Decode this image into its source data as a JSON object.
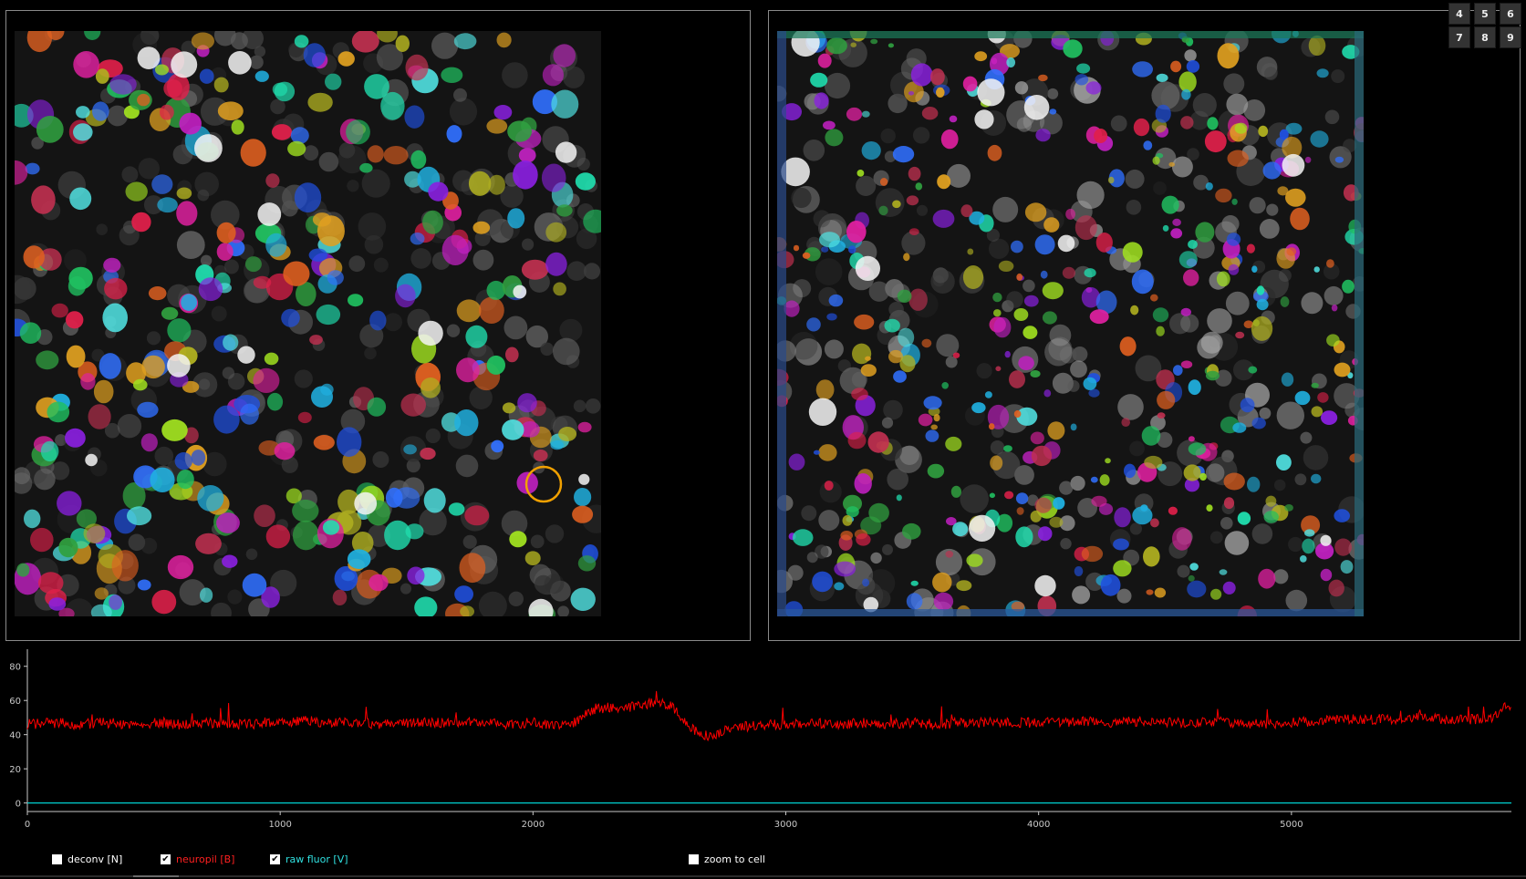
{
  "view_buttons": [
    "4",
    "5",
    "6",
    "7",
    "8",
    "9"
  ],
  "trace_chart": {
    "chart_data": {
      "type": "line",
      "xlim": [
        0,
        5870
      ],
      "ylim": [
        -5,
        90
      ],
      "x_ticks": [
        0,
        1000,
        2000,
        3000,
        4000,
        5000
      ],
      "y_ticks": [
        0,
        20,
        40,
        60,
        80
      ],
      "series": [
        {
          "color": "#ff0000",
          "points": [
            [
              0,
              46
            ],
            [
              100,
              47
            ],
            [
              200,
              46
            ],
            [
              300,
              47
            ],
            [
              400,
              46
            ],
            [
              500,
              47
            ],
            [
              600,
              46
            ],
            [
              700,
              47
            ],
            [
              800,
              46
            ],
            [
              900,
              46
            ],
            [
              1000,
              47
            ],
            [
              1100,
              48
            ],
            [
              1200,
              47
            ],
            [
              1300,
              47
            ],
            [
              1400,
              46
            ],
            [
              1500,
              47
            ],
            [
              1600,
              47
            ],
            [
              1700,
              47
            ],
            [
              1800,
              47
            ],
            [
              1900,
              46
            ],
            [
              2000,
              47
            ],
            [
              2100,
              46
            ],
            [
              2150,
              46
            ],
            [
              2200,
              51
            ],
            [
              2250,
              55
            ],
            [
              2300,
              56
            ],
            [
              2350,
              55
            ],
            [
              2400,
              57
            ],
            [
              2450,
              58
            ],
            [
              2500,
              59
            ],
            [
              2550,
              56
            ],
            [
              2600,
              48
            ],
            [
              2650,
              41
            ],
            [
              2700,
              39
            ],
            [
              2750,
              42
            ],
            [
              2800,
              44
            ],
            [
              2900,
              46
            ],
            [
              3000,
              46
            ],
            [
              3100,
              47
            ],
            [
              3200,
              46
            ],
            [
              3300,
              47
            ],
            [
              3400,
              46
            ],
            [
              3500,
              47
            ],
            [
              3600,
              46
            ],
            [
              3700,
              47
            ],
            [
              3800,
              47
            ],
            [
              3900,
              47
            ],
            [
              4000,
              47
            ],
            [
              4100,
              47
            ],
            [
              4200,
              48
            ],
            [
              4300,
              47
            ],
            [
              4400,
              48
            ],
            [
              4500,
              47
            ],
            [
              4600,
              47
            ],
            [
              4700,
              47
            ],
            [
              4800,
              47
            ],
            [
              4900,
              46
            ],
            [
              5000,
              47
            ],
            [
              5100,
              48
            ],
            [
              5200,
              49
            ],
            [
              5300,
              49
            ],
            [
              5400,
              49
            ],
            [
              5500,
              50
            ],
            [
              5600,
              49
            ],
            [
              5700,
              49
            ],
            [
              5780,
              49
            ],
            [
              5820,
              53
            ],
            [
              5840,
              58
            ],
            [
              5870,
              56
            ]
          ]
        },
        {
          "color": "#00cfcf",
          "points": [
            [
              0,
              0
            ],
            [
              5870,
              0
            ]
          ]
        }
      ]
    }
  },
  "checkboxes": [
    {
      "label": "deconv [N]",
      "checked": false,
      "color": "#ffffff"
    },
    {
      "label": "neuropil [B]",
      "checked": true,
      "color": "#ff2020"
    },
    {
      "label": "raw fluor [V]",
      "checked": true,
      "color": "#30e0e0"
    },
    {
      "label": "zoom to cell",
      "checked": false,
      "color": "#ffffff"
    }
  ]
}
